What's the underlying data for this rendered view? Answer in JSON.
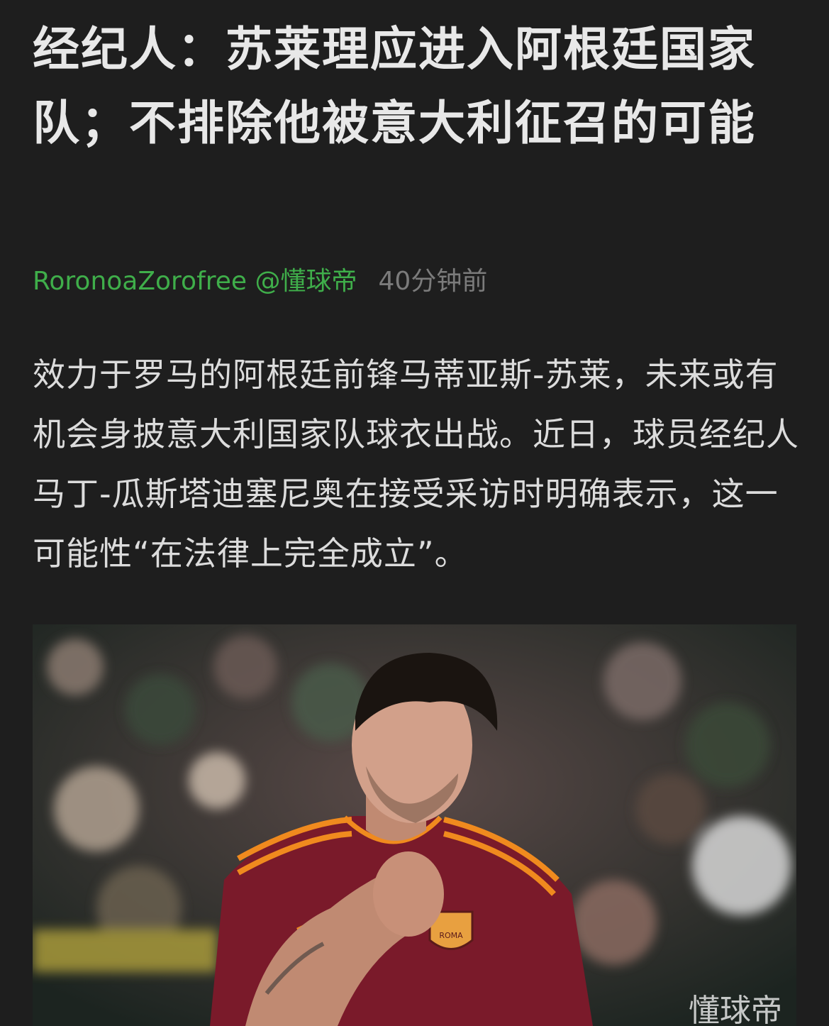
{
  "article": {
    "title": "经纪人：苏莱理应进入阿根廷国家队；不排除他被意大利征召的可能",
    "author": "RoronoaZorofree @懂球帝",
    "time": "40分钟前",
    "body": "效力于罗马的阿根廷前锋马蒂亚斯-苏莱，未来或有机会身披意大利国家队球衣出战。近日，球员经纪人马丁-瓜斯塔迪塞尼奥在接受采访时明确表示，这一可能性“在法律上完全成立”。"
  },
  "photo": {
    "watermark": "懂球帝",
    "crest_text": "ROMA",
    "colors": {
      "jersey": "#7a1a2a",
      "stripe": "#f08a1e",
      "background": "#2a2a2a"
    }
  },
  "colors": {
    "page_bg": "#1e1e1e",
    "author": "#3fae4a",
    "time": "#7b7b7b"
  }
}
